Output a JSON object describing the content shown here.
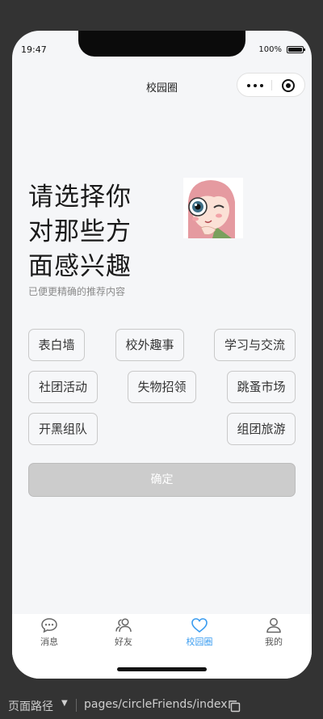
{
  "status": {
    "time": "19:47",
    "battery": "100%",
    "battery_level": 1.0
  },
  "navbar": {
    "title": "校园圈",
    "capsule": {
      "more_icon": "more-dots-icon",
      "close_icon": "target-circle-icon"
    }
  },
  "intro": {
    "headline": [
      "请选择你",
      "对那些方",
      "面感兴趣"
    ],
    "subtitle": "已便更精确的推荐内容",
    "illustration": "cartoon-girl-avatar"
  },
  "tags": [
    "表白墙",
    "校外趣事",
    "学习与交流",
    "社团活动",
    "失物招领",
    "跳蚤市场",
    "开黑组队",
    "组团旅游"
  ],
  "confirm_label": "确定",
  "tabbar": {
    "items": [
      {
        "label": "消息",
        "icon": "chat-bubble-icon",
        "active": false
      },
      {
        "label": "好友",
        "icon": "friends-icon",
        "active": false
      },
      {
        "label": "校园圈",
        "icon": "heart-icon",
        "active": true
      },
      {
        "label": "我的",
        "icon": "user-icon",
        "active": false
      }
    ]
  },
  "colors": {
    "accent": "#3a9cf0",
    "page_bg": "#f5f6f8",
    "confirm_disabled": "#cccccc"
  },
  "pathbar": {
    "label": "页面路径",
    "value": "pages/circleFriends/index",
    "copy_icon": "copy-icon"
  }
}
